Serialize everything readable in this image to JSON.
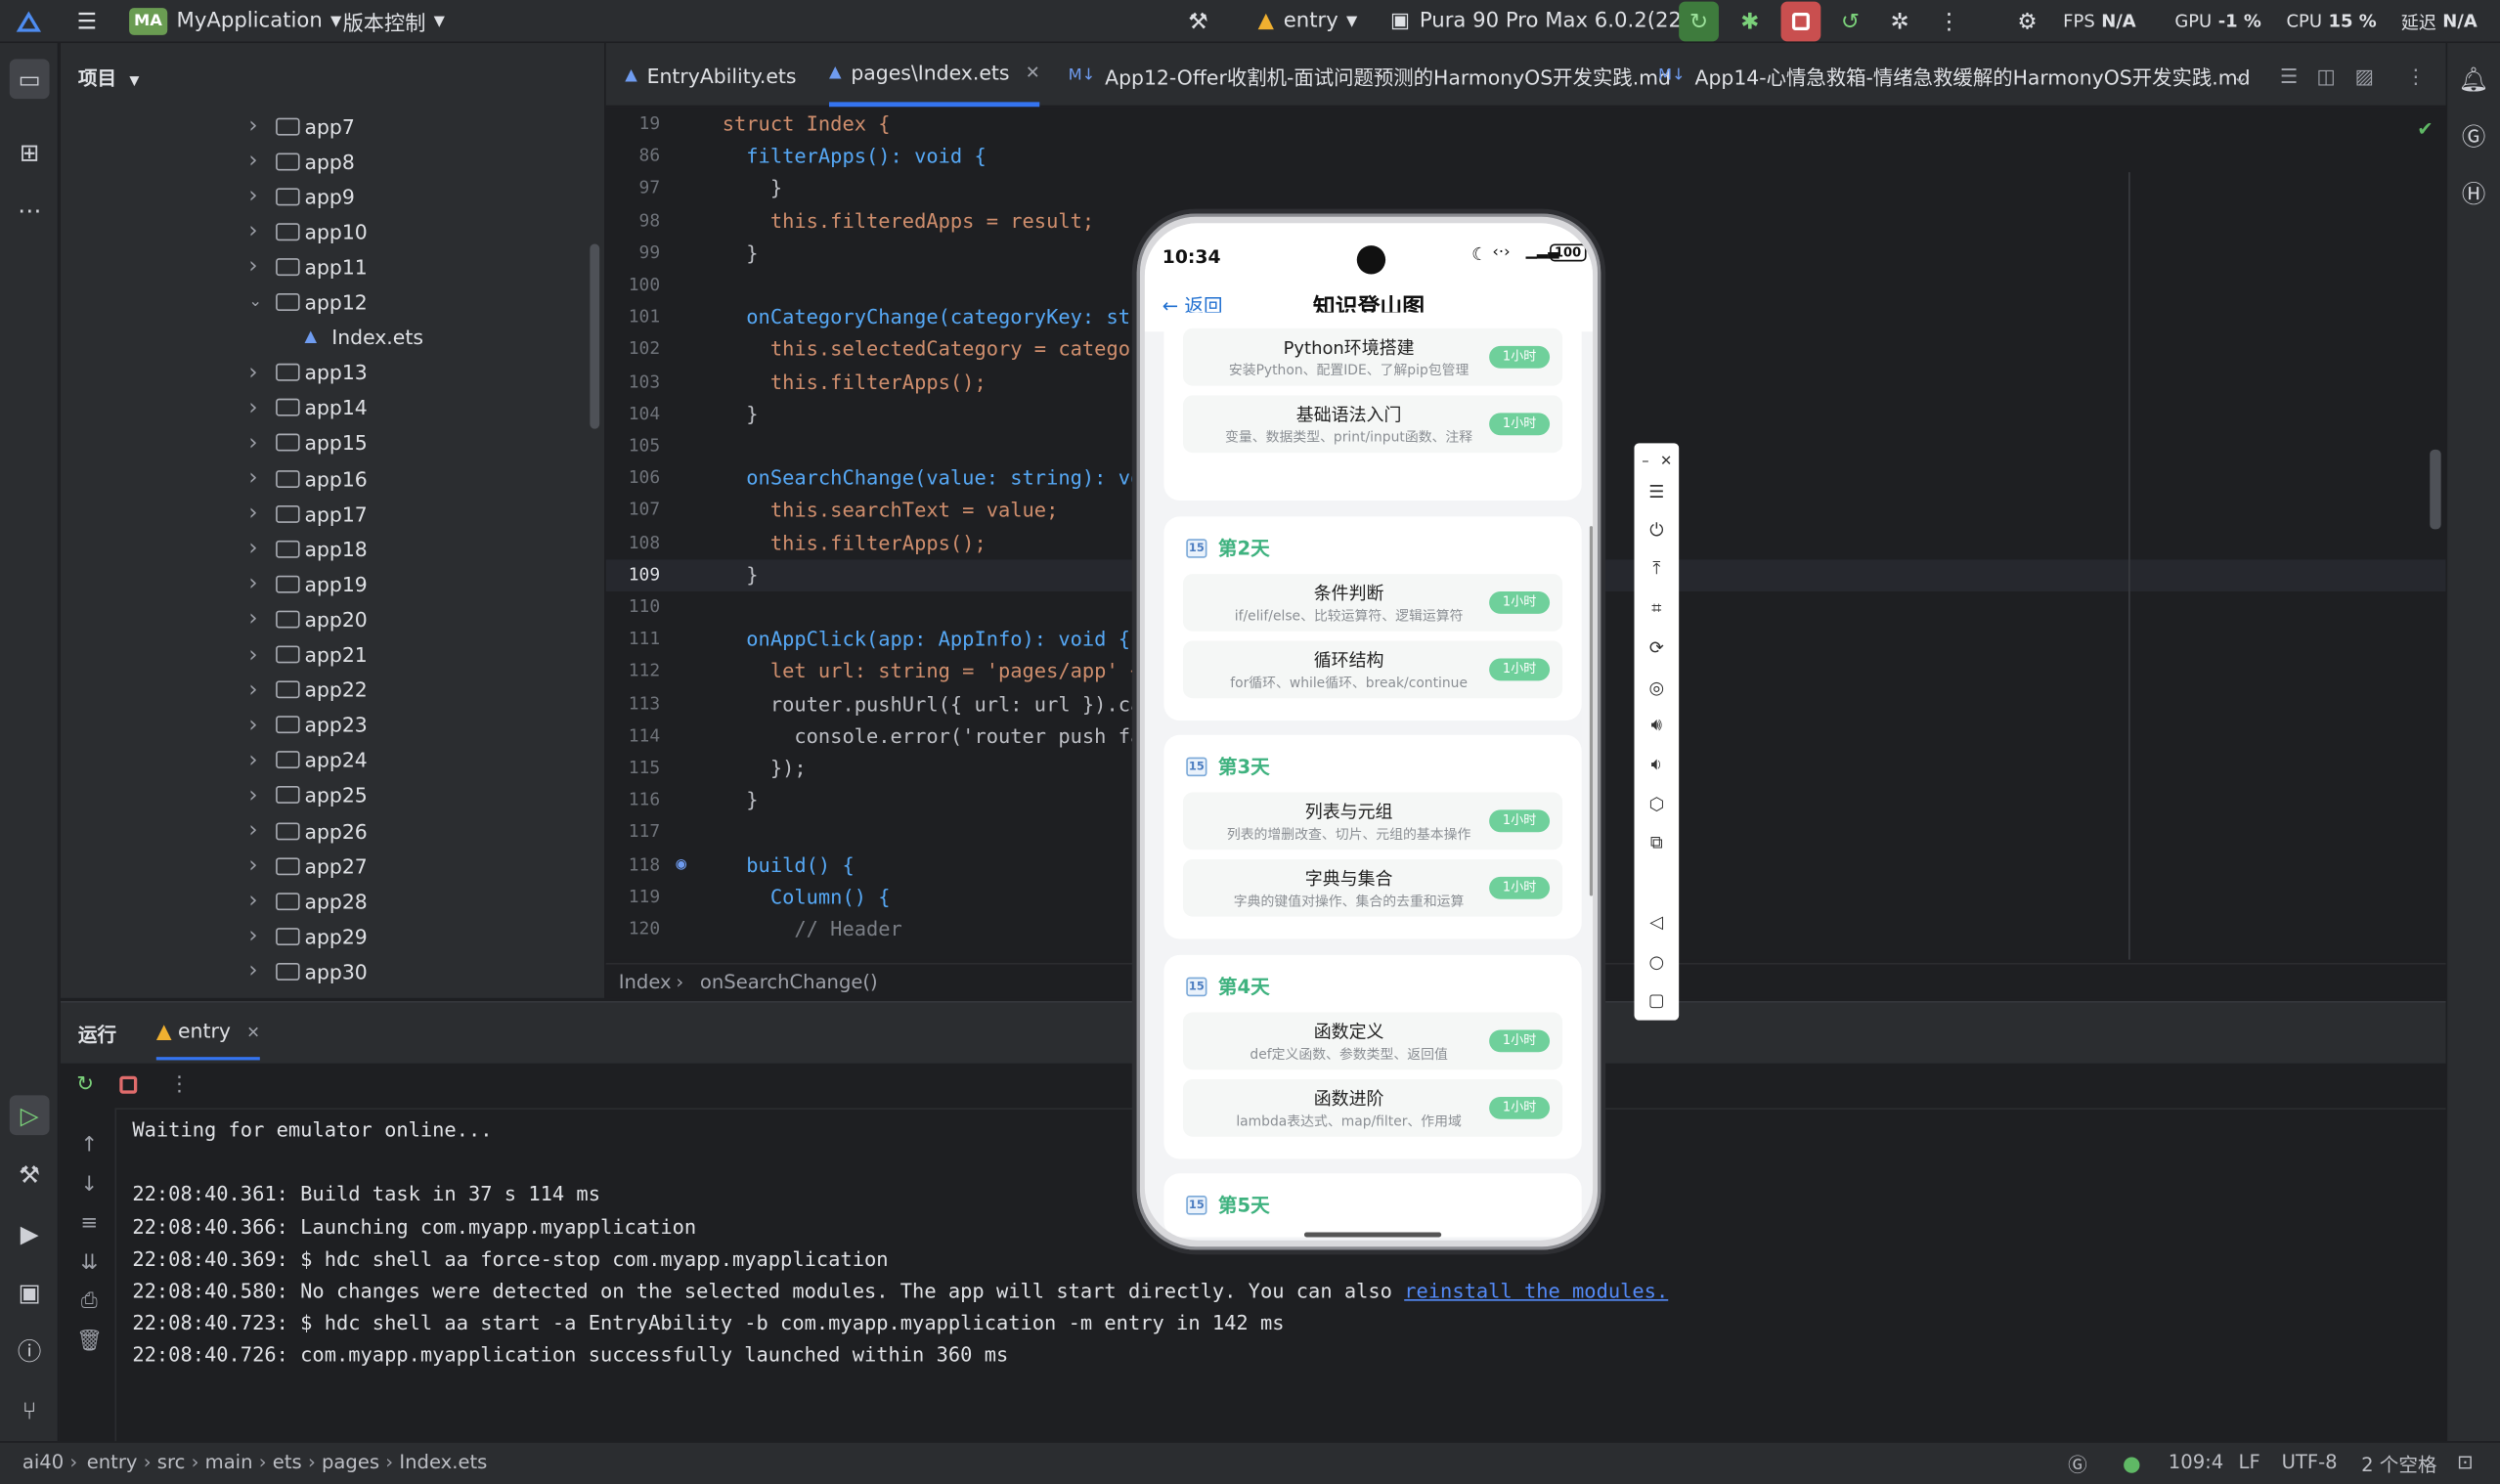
{
  "titlebar": {
    "logo": "MA",
    "app_name": "MyApplication",
    "vcs": "版本控制",
    "run_config": "entry",
    "device": "Pura 90 Pro Max 6.0.2(22)",
    "fps_label": "FPS",
    "fps_value": "N/A",
    "gpu_label": "GPU",
    "gpu_value": "-1 %",
    "cpu_label": "CPU",
    "cpu_value": "15 %",
    "latency_label": "延迟",
    "latency_value": "N/A"
  },
  "project": {
    "title": "项目",
    "items": [
      {
        "label": "app7",
        "open": false
      },
      {
        "label": "app8",
        "open": false
      },
      {
        "label": "app9",
        "open": false
      },
      {
        "label": "app10",
        "open": false
      },
      {
        "label": "app11",
        "open": false
      },
      {
        "label": "app12",
        "open": true
      },
      {
        "label": "Index.ets",
        "file": true
      },
      {
        "label": "app13",
        "open": false
      },
      {
        "label": "app14",
        "open": false
      },
      {
        "label": "app15",
        "open": false
      },
      {
        "label": "app16",
        "open": false
      },
      {
        "label": "app17",
        "open": false
      },
      {
        "label": "app18",
        "open": false
      },
      {
        "label": "app19",
        "open": false
      },
      {
        "label": "app20",
        "open": false
      },
      {
        "label": "app21",
        "open": false
      },
      {
        "label": "app22",
        "open": false
      },
      {
        "label": "app23",
        "open": false
      },
      {
        "label": "app24",
        "open": false
      },
      {
        "label": "app25",
        "open": false
      },
      {
        "label": "app26",
        "open": false
      },
      {
        "label": "app27",
        "open": false
      },
      {
        "label": "app28",
        "open": false
      },
      {
        "label": "app29",
        "open": false
      },
      {
        "label": "app30",
        "open": false
      }
    ]
  },
  "tabs": [
    {
      "label": "EntryAbility.ets",
      "icon": "ets-file-icon"
    },
    {
      "label": "pages\\Index.ets",
      "icon": "ets-file-icon",
      "active": true
    },
    {
      "label": "App12-Offer收割机-面试问题预测的HarmonyOS开发实践.md",
      "icon": "markdown-icon"
    },
    {
      "label": "App14-心情急救箱-情绪急救缓解的HarmonyOS开发实践.md",
      "icon": "markdown-icon"
    }
  ],
  "code": [
    {
      "n": "19",
      "t": "struct Index {"
    },
    {
      "n": "86",
      "t": "  filterApps(): void {"
    },
    {
      "n": "97",
      "t": "    }"
    },
    {
      "n": "98",
      "t": "    this.filteredApps = result;"
    },
    {
      "n": "99",
      "t": "  }"
    },
    {
      "n": "100",
      "t": ""
    },
    {
      "n": "101",
      "t": "  onCategoryChange(categoryKey: str"
    },
    {
      "n": "102",
      "t": "    this.selectedCategory = categor"
    },
    {
      "n": "103",
      "t": "    this.filterApps();"
    },
    {
      "n": "104",
      "t": "  }"
    },
    {
      "n": "105",
      "t": ""
    },
    {
      "n": "106",
      "t": "  onSearchChange(value: string): vo"
    },
    {
      "n": "107",
      "t": "    this.searchText = value;"
    },
    {
      "n": "108",
      "t": "    this.filterApps();"
    },
    {
      "n": "109",
      "t": "  }"
    },
    {
      "n": "110",
      "t": ""
    },
    {
      "n": "111",
      "t": "  onAppClick(app: AppInfo): void {"
    },
    {
      "n": "112",
      "t": "    let url: string = 'pages/app' +"
    },
    {
      "n": "113",
      "t": "    router.pushUrl({ url: url }).ca"
    },
    {
      "n": "114",
      "t": "      console.error('router push fa"
    },
    {
      "n": "115",
      "t": "    });"
    },
    {
      "n": "116",
      "t": "  }"
    },
    {
      "n": "117",
      "t": ""
    },
    {
      "n": "118",
      "t": "  build() {"
    },
    {
      "n": "119",
      "t": "    Column() {"
    },
    {
      "n": "120",
      "t": "      // Header"
    }
  ],
  "editor_crumbs": [
    "Index",
    "onSearchChange()"
  ],
  "run": {
    "tab_run": "运行",
    "tab_entry": "entry",
    "lines": [
      "Waiting for emulator online...",
      "",
      "22:08:40.361: Build task in 37 s 114 ms",
      "22:08:40.366: Launching com.myapp.myapplication",
      "22:08:40.369: $ hdc shell aa force-stop com.myapp.myapplication",
      "22:08:40.580: No changes were detected on the selected modules. The app will start directly. You can also ",
      "22:08:40.723: $ hdc shell aa start -a EntryAbility -b com.myapp.myapplication -m entry in 142 ms",
      "22:08:40.726: com.myapp.myapplication successfully launched within 360 ms"
    ],
    "link": "reinstall the modules."
  },
  "statusbar": {
    "path": [
      "ai40",
      "entry",
      "src",
      "main",
      "ets",
      "pages",
      "Index.ets"
    ],
    "position": "109:4",
    "line_sep": "LF",
    "encoding": "UTF-8",
    "indent": "2 个空格"
  },
  "phone": {
    "time": "10:34",
    "battery": "100",
    "back": "← 返回",
    "title": "知识登山图",
    "days": [
      {
        "label": "",
        "tasks": [
          {
            "title": "Python环境搭建",
            "desc": "安装Python、配置IDE、了解pip包管理",
            "badge": "1小时"
          },
          {
            "title": "基础语法入门",
            "desc": "变量、数据类型、print/input函数、注释",
            "badge": "1小时"
          }
        ]
      },
      {
        "label": "第2天",
        "tasks": [
          {
            "title": "条件判断",
            "desc": "if/elif/else、比较运算符、逻辑运算符",
            "badge": "1小时"
          },
          {
            "title": "循环结构",
            "desc": "for循环、while循环、break/continue",
            "badge": "1小时"
          }
        ]
      },
      {
        "label": "第3天",
        "tasks": [
          {
            "title": "列表与元组",
            "desc": "列表的增删改查、切片、元组的基本操作",
            "badge": "1小时"
          },
          {
            "title": "字典与集合",
            "desc": "字典的键值对操作、集合的去重和运算",
            "badge": "1小时"
          }
        ]
      },
      {
        "label": "第4天",
        "tasks": [
          {
            "title": "函数定义",
            "desc": "def定义函数、参数类型、返回值",
            "badge": "1小时"
          },
          {
            "title": "函数进阶",
            "desc": "lambda表达式、map/filter、作用域",
            "badge": "1小时"
          }
        ]
      },
      {
        "label": "第5天",
        "tasks": []
      }
    ],
    "calendar_glyph": "15"
  },
  "colors": {
    "accent_green": "#3fb27f",
    "badge_green": "#6fd09b",
    "ide_bg": "#1e1f22",
    "panel_bg": "#2b2d30",
    "link": "#548af7"
  }
}
